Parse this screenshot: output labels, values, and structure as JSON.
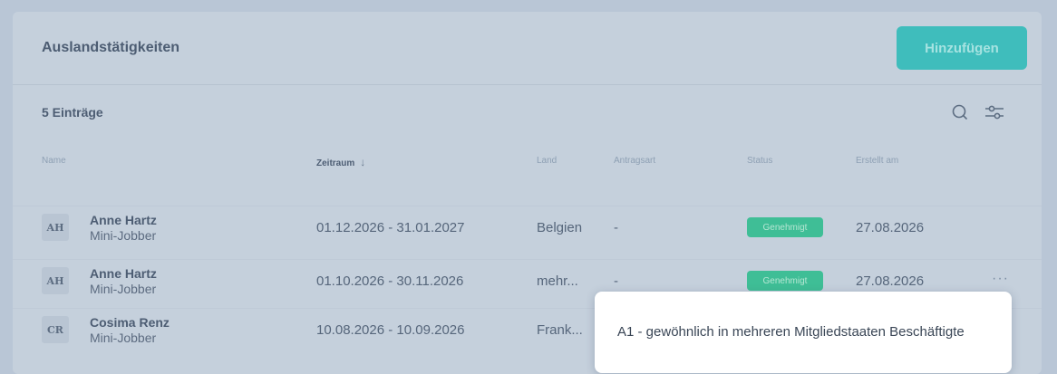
{
  "header": {
    "title": "Auslandstätigkeiten",
    "add_label": "Hinzufügen"
  },
  "toolbar": {
    "entry_count": "5 Einträge",
    "search_icon": "search-icon",
    "filter_icon": "sliders-icon"
  },
  "table": {
    "columns": {
      "name": "Name",
      "zeitraum": "Zeitraum",
      "land": "Land",
      "antragsart": "Antragsart",
      "status": "Status",
      "erstellt": "Erstellt am"
    },
    "rows": [
      {
        "initials": "AH",
        "name": "Anne Hartz",
        "role": "Mini-Jobber",
        "zeitraum": "01.12.2026 - 31.01.2027",
        "land": "Belgien",
        "antragsart": "-",
        "status": "Genehmigt",
        "erstellt": "27.08.2026"
      },
      {
        "initials": "AH",
        "name": "Anne Hartz",
        "role": "Mini-Jobber",
        "zeitraum": "01.10.2026 - 30.11.2026",
        "land": "mehr...",
        "antragsart": "-",
        "status": "Genehmigt",
        "erstellt": "27.08.2026",
        "more": "···"
      },
      {
        "initials": "CR",
        "name": "Cosima Renz",
        "role": "Mini-Jobber",
        "zeitraum": "10.08.2026 - 10.09.2026",
        "land": "Frank..."
      }
    ]
  },
  "tooltip": {
    "text": "A1 - gewöhnlich in mehreren Mitgliedstaaten Beschäftigte"
  },
  "colors": {
    "accent": "#3fbdbc",
    "status_approved": "#3fbe96"
  }
}
